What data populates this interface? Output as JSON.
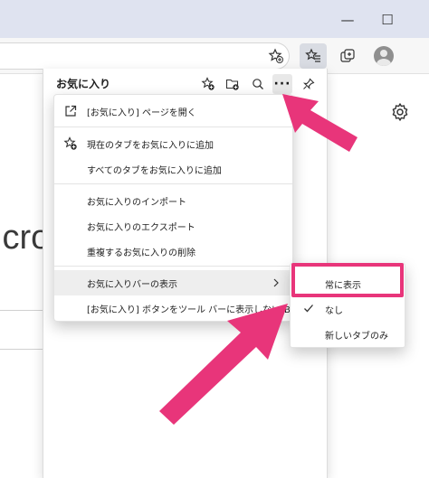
{
  "window": {
    "minimize_glyph": "—",
    "maximize_glyph": "☐"
  },
  "toolbar": {
    "icons": [
      "add-favorite-star-icon",
      "favorites-icon",
      "collections-icon",
      "profile-avatar",
      "more-icon"
    ]
  },
  "page": {
    "partial_text": "icro"
  },
  "favorites_pane": {
    "title": "お気に入り",
    "more_glyph": "···"
  },
  "context_menu": {
    "items": [
      {
        "label": "[お気に入り] ページを開く",
        "icon": "open-external-icon"
      },
      {
        "label": "現在のタブをお気に入りに追加",
        "icon": "add-favorite-star-icon"
      },
      {
        "label": "すべてのタブをお気に入りに追加",
        "icon": ""
      },
      {
        "label": "お気に入りのインポート",
        "icon": ""
      },
      {
        "label": "お気に入りのエクスポート",
        "icon": ""
      },
      {
        "label": "重複するお気に入りの削除",
        "icon": ""
      },
      {
        "label": "お気に入りバーの表示",
        "icon": "",
        "has_submenu": true
      },
      {
        "label": "[お気に入り] ボタンをツール バーに表示しない(B)",
        "icon": ""
      }
    ]
  },
  "submenu": {
    "items": [
      {
        "label": "常に表示",
        "checked": false,
        "highlighted": true
      },
      {
        "label": "なし",
        "checked": true
      },
      {
        "label": "新しいタブのみ",
        "checked": false
      }
    ]
  },
  "colors": {
    "annotation_pink": "#e8357a",
    "titlebar": "#dfe3f0"
  }
}
